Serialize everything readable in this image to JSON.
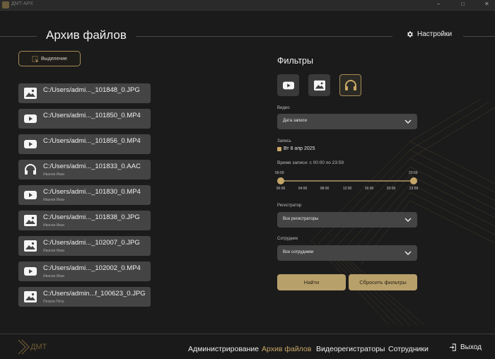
{
  "window": {
    "title": "ДМТ-АРХ"
  },
  "header": {
    "title": "Архив файлов",
    "settings_label": "Настройки"
  },
  "toolbar": {
    "select_label": "Выделение"
  },
  "files": [
    {
      "name": "C:/Users/admi..._101848_0.JPG",
      "owner": "",
      "type": "image"
    },
    {
      "name": "C:/Users/admi..._101850_0.MP4",
      "owner": "",
      "type": "video"
    },
    {
      "name": "C:/Users/admi..._101856_0.MP4",
      "owner": "",
      "type": "video"
    },
    {
      "name": "C:/Users/admi..._101833_0.AAC",
      "owner": "Иванов Иван",
      "type": "audio"
    },
    {
      "name": "C:/Users/admi..._101830_0.MP4",
      "owner": "Иванов Иван",
      "type": "video"
    },
    {
      "name": "C:/Users/admi..._101838_0.JPG",
      "owner": "Иванов Иван",
      "type": "image"
    },
    {
      "name": "C:/Users/admi..._102007_0.JPG",
      "owner": "Иванов Иван",
      "type": "image"
    },
    {
      "name": "C:/Users/admi..._102002_0.MP4",
      "owner": "Иванов Иван",
      "type": "video"
    },
    {
      "name": "C:/Users/admin...f_100623_0.JPG",
      "owner": "Петров Пётр",
      "type": "image"
    }
  ],
  "filters": {
    "title": "Фильтры",
    "type_buttons": [
      "video-filter",
      "image-filter",
      "audio-filter"
    ],
    "active_type": "audio",
    "video_label": "Видео",
    "sort_value": "Дата записи",
    "record_label": "Запись",
    "record_date": "Вт 8 апр 2025",
    "time_label": "Время записи: с 00:00 по 23:59",
    "time_start": "00:00",
    "time_end": "23:59",
    "ticks": [
      "00:00",
      "04:00",
      "08:00",
      "12:00",
      "16:00",
      "20:00",
      "23:59"
    ],
    "registrar_label": "Регистратор",
    "registrar_value": "Все регистраторы",
    "employee_label": "Сотрудник",
    "employee_value": "Все сотрудники",
    "find_label": "Найти",
    "reset_label": "Сбросить фильтры"
  },
  "footer": {
    "logo_text": "ДМТ",
    "nav": [
      "Администрирование",
      "Архив файлов",
      "Видеорегистраторы",
      "Сотрудники"
    ],
    "active_nav": "Архив файлов",
    "logout_label": "Выход"
  },
  "colors": {
    "accent": "#c9a867",
    "background": "#1b1b1b",
    "card": "#444444"
  }
}
